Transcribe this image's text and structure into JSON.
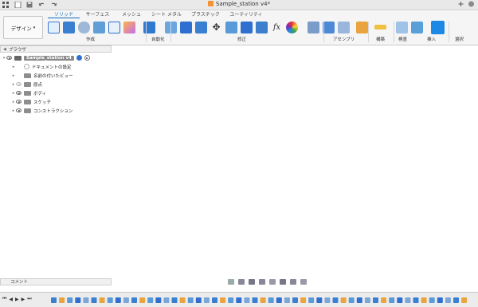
{
  "titlebar": {
    "document_title": "Sample_station v4*"
  },
  "ribbon": {
    "design_label": "デザイン",
    "tabs": [
      {
        "label": "ソリッド",
        "active": true
      },
      {
        "label": "サーフェス",
        "active": false
      },
      {
        "label": "メッシュ",
        "active": false
      },
      {
        "label": "シート メタル",
        "active": false
      },
      {
        "label": "プラスチック",
        "active": false
      },
      {
        "label": "ユーティリティ",
        "active": false
      }
    ],
    "groups": [
      "作成",
      "自動化",
      "修正",
      "アセンブリ",
      "構築",
      "検査",
      "挿入",
      "選択"
    ]
  },
  "browser": {
    "title": "ブラウザ",
    "root": "Sample_station v4",
    "items": [
      {
        "label": "ドキュメントの設定",
        "icon": "gear-icon"
      },
      {
        "label": "名前の付いたビュー",
        "icon": "folder-icon"
      },
      {
        "label": "原点",
        "icon": "folder-icon"
      },
      {
        "label": "ボディ",
        "icon": "folder-icon"
      },
      {
        "label": "スケッチ",
        "icon": "folder-icon"
      },
      {
        "label": "コンストラクション",
        "icon": "folder-icon"
      }
    ]
  },
  "comments": {
    "label": "コメント"
  },
  "colors": {
    "accent": "#0d6ebf",
    "roof": "#3a3a3a",
    "wall": "#a9a9a6"
  }
}
